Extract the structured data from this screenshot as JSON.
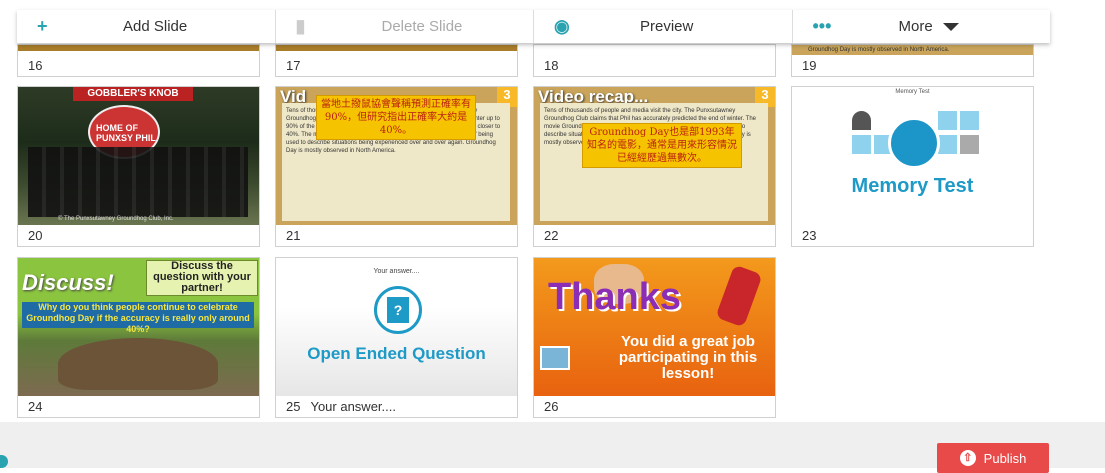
{
  "toolbar": {
    "add": {
      "icon": "plus-icon",
      "label": "Add Slide"
    },
    "delete": {
      "icon": "trash-icon",
      "label": "Delete Slide"
    },
    "preview": {
      "icon": "eye-icon",
      "label": "Preview"
    },
    "more": {
      "icon": "ellipsis-icon",
      "label": "More"
    }
  },
  "slides": {
    "s16": {
      "number": "16"
    },
    "s17": {
      "number": "17"
    },
    "s18": {
      "number": "18"
    },
    "s19": {
      "number": "19",
      "caption": "Groundhog Day is mostly observed in North America."
    },
    "s20": {
      "number": "20",
      "sign": "GOBBLER'S KNOB",
      "sign2": "HOME OF PUNXSY PHIL",
      "credit": "© The Punxsutawney Groundhog Club, Inc."
    },
    "s21": {
      "number": "21",
      "title": "Vid",
      "badge": "3",
      "note": "當地土撥鼠協會聲稱預測正確率有90%，但研究指出正確率大約是40%。",
      "text": "Tens of thousands of people and media visit the city. The Punxsutawney Groundhog Club claims that Phil has accurately predicted the end of winter up to 90% of the time, though studies have shown his accuracy to actually be closer to 40%. The movie Groundhog Day led to the expression 'Groundhog Day' being used to describe situations being experienced over and over again. Groundhog Day is mostly observed in North America."
    },
    "s22": {
      "number": "22",
      "title": "Video recap...",
      "badge": "3",
      "note": "Groundhog Day也是部1993年知名的電影，通常是用來形容情況已經經歷過無數次。",
      "text": "Tens of thousands of people and media visit the city. The Punxsutawney Groundhog Club claims that Phil has accurately predicted the end of winter. The movie Groundhog Day led to the expression 'Groundhog Day' being used to describe situations being experienced over and over again. Groundhog Day is mostly observed in North America."
    },
    "s23": {
      "number": "23",
      "top": "Memory Test",
      "label": "Memory Test"
    },
    "s24": {
      "number": "24",
      "word": "Discuss!",
      "box": "Discuss the question with your partner!",
      "question": "Why do you think people continue to celebrate Groundhog Day if the accuracy is really only around 40%?"
    },
    "s25": {
      "number": "25",
      "extra": "Your answer....",
      "top": "Your answer....",
      "label": "Open Ended Question"
    },
    "s26": {
      "number": "26",
      "word": "Thanks",
      "message": "You did a great job participating in this lesson!"
    }
  },
  "footer": {
    "publish": {
      "icon": "upload-icon",
      "label": "Publish"
    }
  }
}
